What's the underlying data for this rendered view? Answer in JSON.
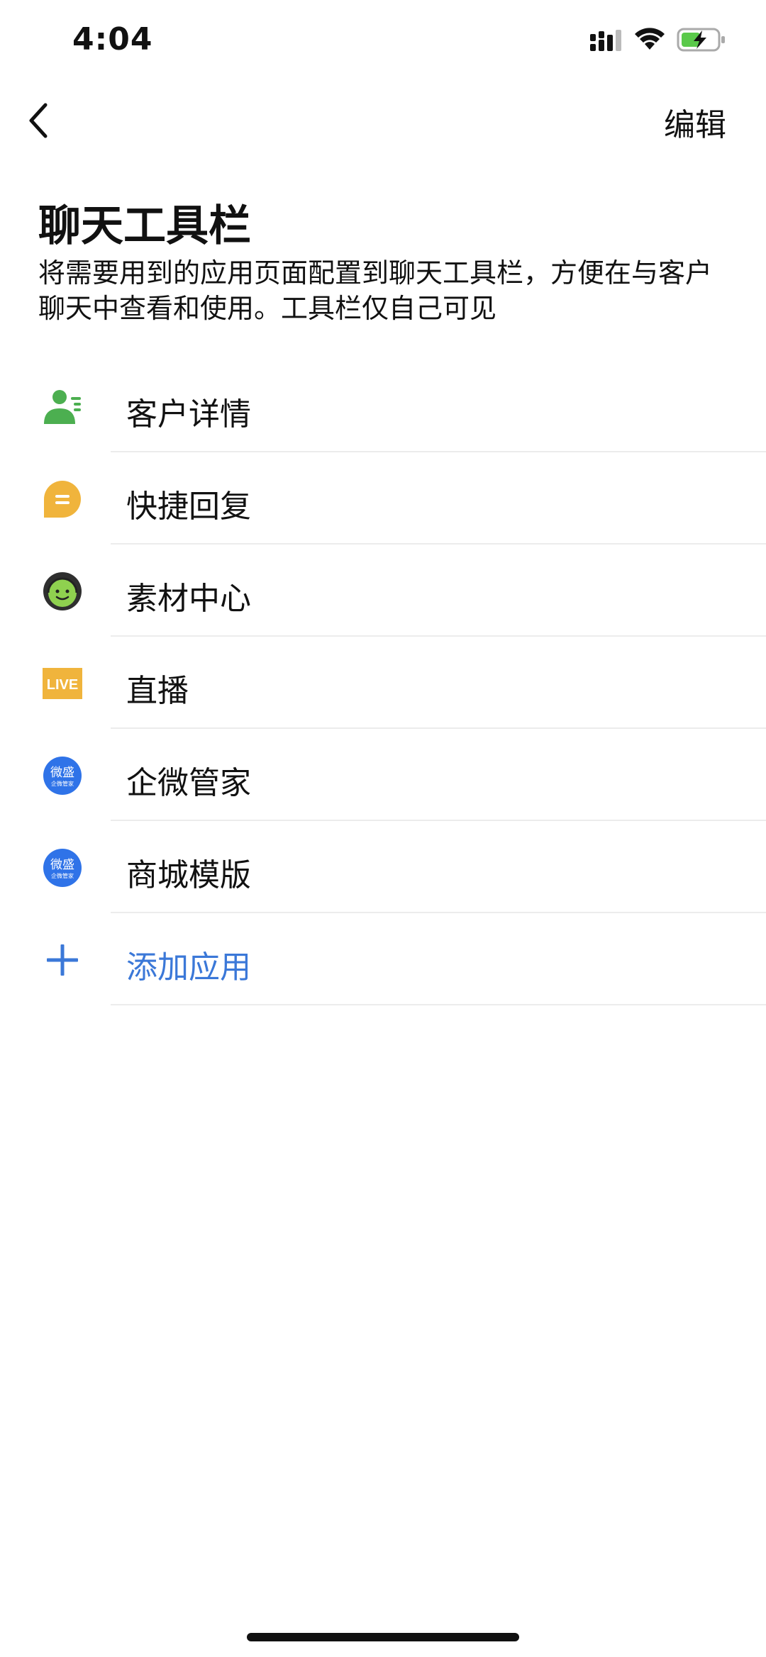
{
  "status": {
    "time": "4:04"
  },
  "nav": {
    "edit_label": "编辑"
  },
  "page": {
    "title": "聊天工具栏",
    "description": "将需要用到的应用页面配置到聊天工具栏，方便在与客户聊天中查看和使用。工具栏仅自己可见"
  },
  "items": [
    {
      "label": "客户详情",
      "icon": "customer-detail-icon",
      "color": "#4caf50"
    },
    {
      "label": "快捷回复",
      "icon": "quick-reply-icon",
      "color": "#f0b43c"
    },
    {
      "label": "素材中心",
      "icon": "material-center-icon",
      "color": "#7cc242"
    },
    {
      "label": "直播",
      "icon": "live-icon",
      "color": "#f0b43c",
      "badge": "LIVE"
    },
    {
      "label": "企微管家",
      "icon": "weisheng-icon",
      "color": "#2f73e8",
      "badge": "微盛",
      "sub": "企微管家"
    },
    {
      "label": "商城模版",
      "icon": "weisheng-icon",
      "color": "#2f73e8",
      "badge": "微盛",
      "sub": "企微管家"
    }
  ],
  "add": {
    "label": "添加应用",
    "color": "#3b78d8"
  }
}
